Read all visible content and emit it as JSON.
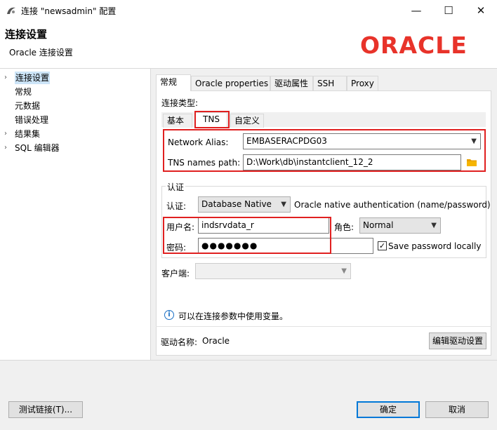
{
  "window": {
    "title": "连接 \"newsadmin\" 配置",
    "minimize_glyph": "—",
    "maximize_glyph": "☐",
    "close_glyph": "✕"
  },
  "header": {
    "title": "连接设置",
    "subtitle": "Oracle 连接设置",
    "logo_text": "ORACLE",
    "logo_color": "#e8332a"
  },
  "tree": {
    "items": [
      {
        "label": "连接设置",
        "arrow": "›"
      },
      {
        "label": "常规",
        "arrow": ""
      },
      {
        "label": "元数据",
        "arrow": ""
      },
      {
        "label": "错误处理",
        "arrow": ""
      },
      {
        "label": "结果集",
        "arrow": "›"
      },
      {
        "label": "SQL 编辑器",
        "arrow": "›"
      }
    ]
  },
  "tabs": [
    "常规",
    "Oracle properties",
    "驱动属性",
    "SSH",
    "Proxy"
  ],
  "connection_type": {
    "label": "连接类型:",
    "subtabs": [
      "基本",
      "TNS",
      "自定义"
    ]
  },
  "tns": {
    "alias_label": "Network Alias:",
    "alias_value": "EMBASERACPDG03",
    "path_label": "TNS names path:",
    "path_value": "D:\\Work\\db\\instantclient_12_2",
    "folder_icon": "folder-icon"
  },
  "auth": {
    "group_title": "认证",
    "auth_label": "认证:",
    "auth_value": "Database Native",
    "auth_desc": "Oracle native authentication (name/password)",
    "username_label": "用户名:",
    "username_value": "indsrvdata_r",
    "role_label": "角色:",
    "role_value": "Normal",
    "password_label": "密码:",
    "password_value": "●●●●●●●",
    "save_password_label": "Save password locally",
    "save_password_checked": "✓"
  },
  "client": {
    "label": "客户端:",
    "value": ""
  },
  "info": {
    "icon": "info-icon",
    "text": "可以在连接参数中使用变量。"
  },
  "driver": {
    "label": "驱动名称:",
    "name": "Oracle",
    "edit_button": "编辑驱动设置"
  },
  "footer": {
    "test_button": "测试链接(T)...",
    "ok_button": "确定",
    "cancel_button": "取消"
  },
  "colors": {
    "highlight_box": "#e02020",
    "selection": "#cce4f7",
    "default_button_border": "#0078d7"
  }
}
